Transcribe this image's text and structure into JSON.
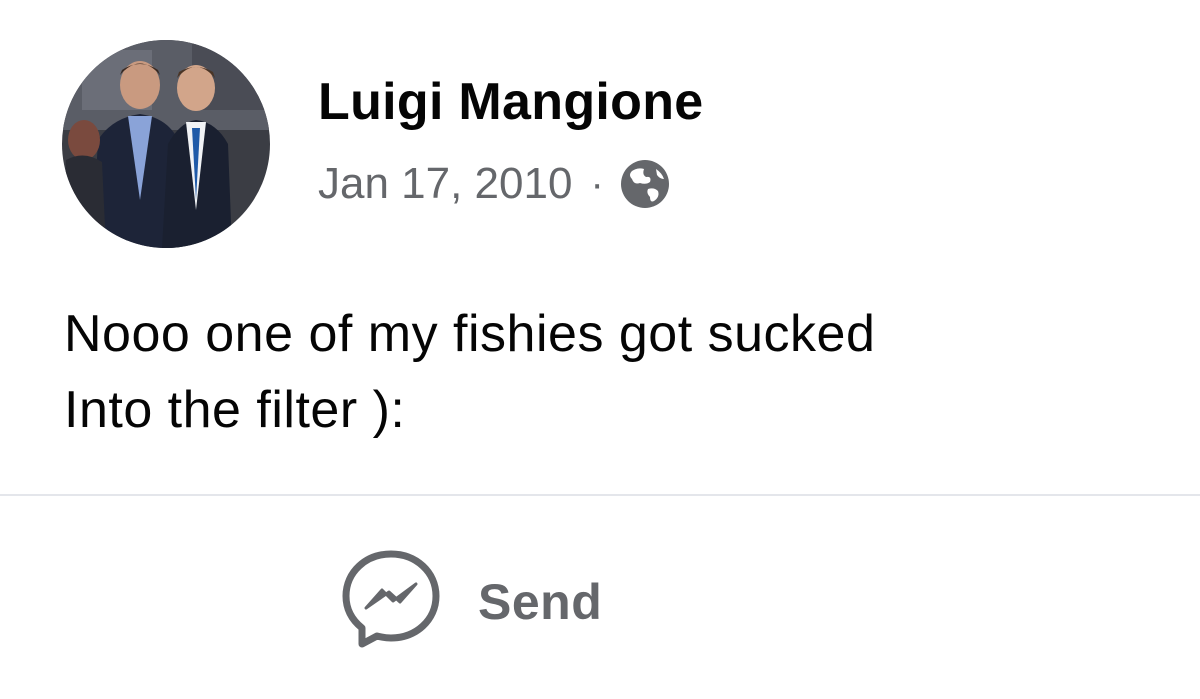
{
  "post": {
    "author": "Luigi Mangione",
    "date": "Jan 17, 2010",
    "separator": "·",
    "privacy_icon": "globe-icon",
    "text_lines": [
      "Nooo one of my fishies got sucked",
      "Into the filter ):"
    ]
  },
  "actions": {
    "send_label": "Send",
    "send_icon": "messenger-icon"
  },
  "colors": {
    "primary_text": "#050505",
    "secondary_text": "#65676b",
    "divider": "#e4e6eb"
  }
}
